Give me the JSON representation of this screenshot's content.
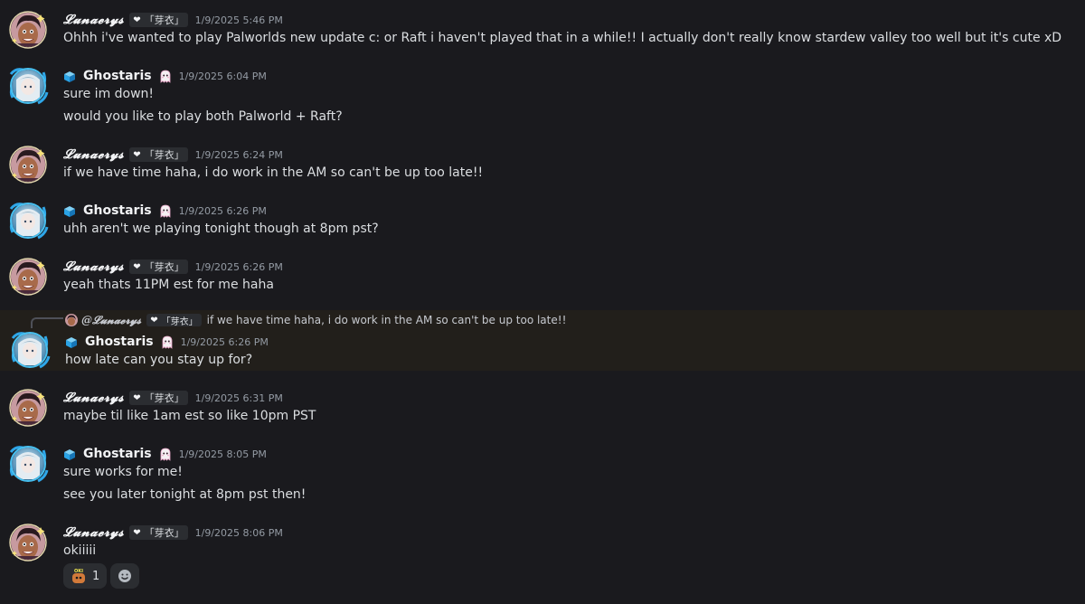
{
  "users": {
    "lunaerys": {
      "name": "𝓛𝓾𝓷𝓪𝓮𝓻𝔂𝓼",
      "tag": "「芽衣」"
    },
    "ghostaris": {
      "name": "Ghostaris"
    }
  },
  "messages": [
    {
      "author": "lunaerys",
      "time": "1/9/2025 5:46 PM",
      "lines": [
        "Ohhh i've wanted to play Palworlds new update c: or Raft i haven't played that in a while!! I actually don't really know stardew valley too well but it's cute xD"
      ]
    },
    {
      "author": "ghostaris",
      "time": "1/9/2025 6:04 PM",
      "lines": [
        "sure im down!",
        "would you like to play both Palworld + Raft?"
      ]
    },
    {
      "author": "lunaerys",
      "time": "1/9/2025 6:24 PM",
      "lines": [
        "if we have time haha, i do work in the AM so can't be up too late!!"
      ]
    },
    {
      "author": "ghostaris",
      "time": "1/9/2025 6:26 PM",
      "lines": [
        "uhh aren't we playing tonight though at 8pm pst?"
      ]
    },
    {
      "author": "lunaerys",
      "time": "1/9/2025 6:26 PM",
      "lines": [
        "yeah thats 11PM est for me haha"
      ]
    },
    {
      "author": "ghostaris",
      "time": "1/9/2025 6:26 PM",
      "reply": {
        "mention": "@𝓛𝓾𝓷𝓪𝓮𝓻𝔂𝓼",
        "tag": "「芽衣」",
        "text": "if we have time haha, i do work in the AM so can't be up too late!!"
      },
      "lines": [
        "how late can you stay up for?"
      ]
    },
    {
      "author": "lunaerys",
      "time": "1/9/2025 6:31 PM",
      "lines": [
        "maybe til like 1am est so like 10pm PST"
      ]
    },
    {
      "author": "ghostaris",
      "time": "1/9/2025 8:05 PM",
      "lines": [
        "sure works for me!",
        "see you later tonight at 8pm pst then!"
      ]
    },
    {
      "author": "lunaerys",
      "time": "1/9/2025 8:06 PM",
      "lines": [
        "okiiiii"
      ],
      "reactions": [
        {
          "emoji": "oki-sticker",
          "count": "1"
        }
      ]
    }
  ],
  "colors": {
    "background": "#1a1a1e",
    "highlight": "#221f1b",
    "text": "#dbdee1",
    "timestamp": "#949ba4",
    "cube": "#2aa3e6",
    "ghost": "#f0b6d5"
  }
}
